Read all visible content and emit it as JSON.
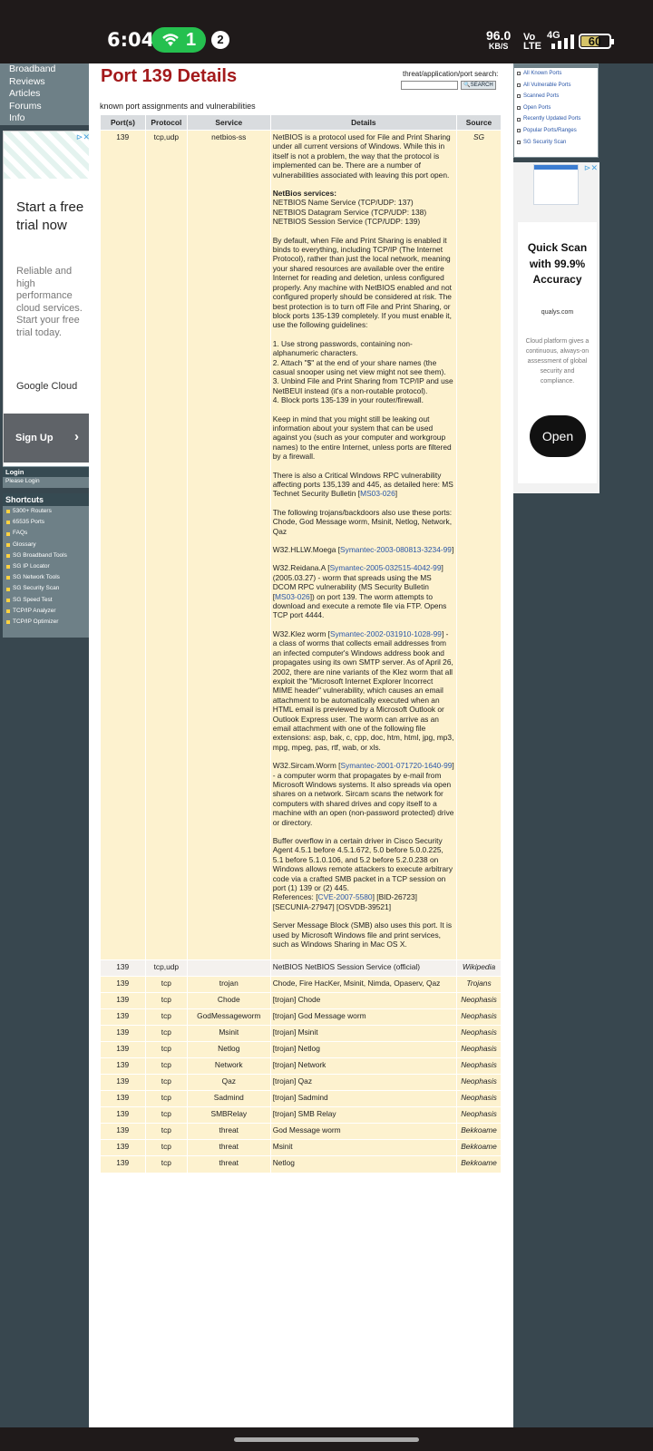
{
  "status_bar": {
    "time": "6:04",
    "hotspot_count": "1",
    "notification_count": "2",
    "speed_value": "96.0",
    "speed_unit": "KB/S",
    "volte_top": "Vo",
    "volte_bottom": "LTE",
    "network": "4G",
    "battery": "60"
  },
  "left_nav": {
    "items": [
      "Broadband",
      "Reviews",
      "Articles",
      "Forums",
      "Info"
    ]
  },
  "left_ad": {
    "headline": "Start a free trial now",
    "body": "Reliable and high performance cloud services. Start your free trial today.",
    "brand": "Google Cloud",
    "cta": "Sign Up",
    "cta_arrow": "›"
  },
  "login_box": {
    "title": "Login",
    "subtitle": "Please Login"
  },
  "shortcuts": {
    "title": "Shortcuts",
    "items": [
      "5300+ Routers",
      "65535 Ports",
      "FAQs",
      "Glossary",
      "SG Broadband Tools",
      "SG IP Locator",
      "SG Network Tools",
      "SG Security Scan",
      "SG Speed Test",
      "TCP/IP Analyzer",
      "TCP/IP Optimizer"
    ]
  },
  "page": {
    "title": "Port 139 Details",
    "subtitle": "known port assignments and vulnerabilities",
    "search_label": "threat/application/port search:",
    "search_button": "SEARCH",
    "search_value": ""
  },
  "table": {
    "headers": [
      "Port(s)",
      "Protocol",
      "Service",
      "Details",
      "Source"
    ],
    "main_row": {
      "port": "139",
      "protocol": "tcp,udp",
      "service": "netbios-ss",
      "source": "SG",
      "p1": "NetBIOS is a protocol used for File and Print Sharing under all current versions of Windows. While this in itself is not a problem, the way that the protocol is implemented can be. There are a number of vulnerabilities associated with leaving this port open.",
      "services_heading": "NetBios services:",
      "services": [
        "NETBIOS Name Service (TCP/UDP: 137)",
        "NETBIOS Datagram Service (TCP/UDP: 138)",
        "NETBIOS Session Service (TCP/UDP: 139)"
      ],
      "p2": "By default, when File and Print Sharing is enabled it binds to everything, including TCP/IP (The Internet Protocol), rather than just the local network, meaning your shared resources are available over the entire Internet for reading and deletion, unless configured properly. Any machine with NetBIOS enabled and not configured properly should be considered at risk. The best protection is to turn off File and Print Sharing, or block ports 135-139 completely. If you must enable it, use the following guidelines:",
      "guidelines": [
        "1. Use strong passwords, containing non-alphanumeric characters.",
        "2. Attach \"$\" at the end of your share names (the casual snooper using net view might not see them).",
        "3. Unbind File and Print Sharing from TCP/IP and use NetBEUI instead (it's a non-routable protocol).",
        "4. Block ports 135-139 in your router/firewall."
      ],
      "p3": "Keep in mind that you might still be leaking out information about your system that can be used against you (such as your computer and workgroup names) to the entire Internet, unless ports are filtered by a firewall.",
      "p4_text": "There is also a Critical Windows RPC vulnerability affecting ports 135,139 and 445, as detailed here: MS Technet Security Bulletin [",
      "p4_link": "MS03-026",
      "p4_end": "]",
      "p5": "The following trojans/backdoors also use these ports:",
      "p5b": "Chode, God Message worm, Msinit, Netlog, Network, Qaz",
      "p6_text": "W32.HLLW.Moega [",
      "p6_link": "Symantec-2003-080813-3234-99",
      "p6_end": "]",
      "p7_a": "W32.Reidana.A [",
      "p7_link1": "Symantec-2005-032515-4042-99",
      "p7_b": "] (2005.03.27) - worm that spreads using the MS DCOM RPC vulnerability (MS Security Bulletin [",
      "p7_link2": "MS03-026",
      "p7_c": "]) on port 139. The worm attempts to download and execute a remote file via FTP. Opens TCP port 4444.",
      "p8_a": "W32.Klez worm [",
      "p8_link": "Symantec-2002-031910-1028-99",
      "p8_b": "] - a class of worms that collects email addresses from an infected computer's Windows address book and propagates using its own SMTP server. As of April 26, 2002, there are nine variants of the Klez worm that all exploit the \"Microsoft Internet Explorer Incorrect MIME header\" vulnerability, which causes an email attachment to be automatically executed when an HTML email is previewed by a Microsoft Outlook or Outlook Express user. The worm can arrive as an email attachment with one of the following file extensions: asp, bak, c, cpp, doc, htm, html, jpg, mp3, mpg, mpeg, pas, rtf, wab, or xls.",
      "p9_a": "W32.Sircam.Worm [",
      "p9_link": "Symantec-2001-071720-1640-99",
      "p9_b": "] - a computer worm that propagates by e-mail from Microsoft Windows systems. It also spreads via open shares on a network. Sircam scans the network for computers with shared drives and copy itself to a machine with an open (non-password protected) drive or directory.",
      "p10": "Buffer overflow in a certain driver in Cisco Security Agent 4.5.1 before 4.5.1.672, 5.0 before 5.0.0.225, 5.1 before 5.1.0.106, and 5.2 before 5.2.0.238 on Windows allows remote attackers to execute arbitrary code via a crafted SMB packet in a TCP session on port (1) 139 or (2) 445.",
      "p10_ref_label": "References: [",
      "p10_ref_link": "CVE-2007-5580",
      "p10_ref_rest": "] [BID-26723] [SECUNIA-27947] [OSVDB-39521]",
      "p11": "Server Message Block (SMB) also uses this port. It is used by Microsoft Windows file and print services, such as Windows Sharing in Mac OS X."
    },
    "rows": [
      {
        "port": "139",
        "protocol": "tcp,udp",
        "service": "",
        "details": "NetBIOS NetBIOS Session Service (official)",
        "source": "Wikipedia"
      },
      {
        "port": "139",
        "protocol": "tcp",
        "service": "trojan",
        "details": "Chode, Fire HacKer, Msinit, Nimda, Opaserv, Qaz",
        "source": "Trojans"
      },
      {
        "port": "139",
        "protocol": "tcp",
        "service": "Chode",
        "details": "[trojan] Chode",
        "source": "Neophasis"
      },
      {
        "port": "139",
        "protocol": "tcp",
        "service": "GodMessageworm",
        "details": "[trojan] God Message worm",
        "source": "Neophasis"
      },
      {
        "port": "139",
        "protocol": "tcp",
        "service": "Msinit",
        "details": "[trojan] Msinit",
        "source": "Neophasis"
      },
      {
        "port": "139",
        "protocol": "tcp",
        "service": "Netlog",
        "details": "[trojan] Netlog",
        "source": "Neophasis"
      },
      {
        "port": "139",
        "protocol": "tcp",
        "service": "Network",
        "details": "[trojan] Network",
        "source": "Neophasis"
      },
      {
        "port": "139",
        "protocol": "tcp",
        "service": "Qaz",
        "details": "[trojan] Qaz",
        "source": "Neophasis"
      },
      {
        "port": "139",
        "protocol": "tcp",
        "service": "Sadmind",
        "details": "[trojan] Sadmind",
        "source": "Neophasis"
      },
      {
        "port": "139",
        "protocol": "tcp",
        "service": "SMBRelay",
        "details": "[trojan] SMB Relay",
        "source": "Neophasis"
      },
      {
        "port": "139",
        "protocol": "tcp",
        "service": "threat",
        "details": "God Message worm",
        "source": "Bekkoame"
      },
      {
        "port": "139",
        "protocol": "tcp",
        "service": "threat",
        "details": "Msinit",
        "source": "Bekkoame"
      },
      {
        "port": "139",
        "protocol": "tcp",
        "service": "threat",
        "details": "Netlog",
        "source": "Bekkoame"
      }
    ]
  },
  "right_links": {
    "items": [
      "All Known Ports",
      "All Vulnerable Ports",
      "Scanned Ports",
      "Open Ports",
      "Recently Updated Ports",
      "Popular Ports/Ranges",
      "SG Security Scan"
    ]
  },
  "right_ad": {
    "headline": "Quick Scan with 99.9% Accuracy",
    "domain": "qualys.com",
    "desc": "Cloud platform gives a continuous, always-on assessment of global security and compliance.",
    "cta": "Open"
  }
}
